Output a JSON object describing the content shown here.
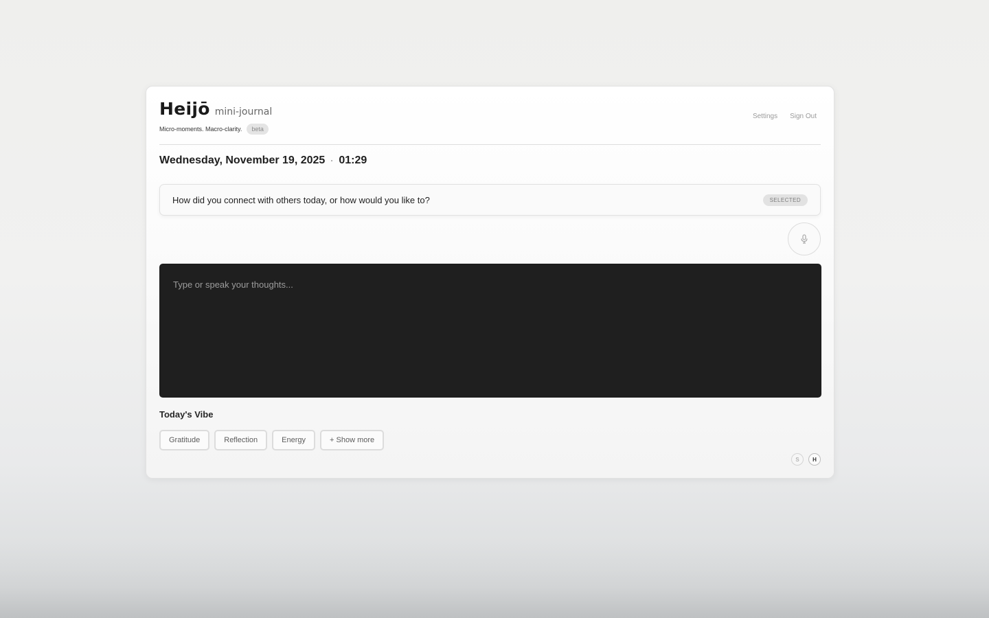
{
  "brand": {
    "name": "Heijō",
    "subtitle": "mini-journal",
    "tagline": "Micro-moments. Macro-clarity.",
    "badge": "beta"
  },
  "header_links": {
    "settings": "Settings",
    "sign_out": "Sign Out"
  },
  "entry": {
    "date": "Wednesday, November 19, 2025",
    "separator": "·",
    "time": "01:29"
  },
  "prompt": {
    "text": "How did you connect with others today, or how would you like to?",
    "status": "SELECTED"
  },
  "editor": {
    "value": "",
    "placeholder": "Type or speak your thoughts..."
  },
  "icons": {
    "mic": "microphone-icon"
  },
  "vibe": {
    "title": "Today's Vibe",
    "chips": [
      "Gratitude",
      "Reflection",
      "Energy"
    ],
    "show_more": "+ Show more"
  },
  "avatars": {
    "first": "S",
    "second": "H"
  },
  "colors": {
    "editor_bg": "#1f1f1f",
    "badge_bg": "#e2e2e2"
  }
}
